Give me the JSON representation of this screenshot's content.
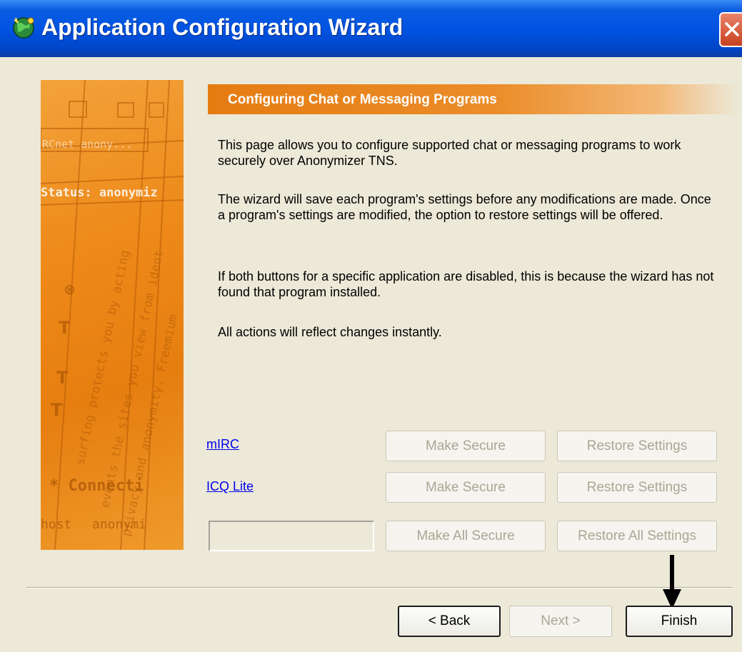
{
  "window": {
    "title": "Application Configuration Wizard",
    "icon": "globe-wizard-icon",
    "close_icon": "close-icon"
  },
  "banner": {
    "image": "anonymizer-banner-image",
    "texts": [
      "RCnet anony...",
      "Status: anonymiz",
      "* Connecti",
      "host",
      "anonymi"
    ]
  },
  "section": {
    "title": "Configuring Chat or Messaging Programs"
  },
  "paragraphs": [
    "This page allows you to configure supported chat or messaging programs to work securely over Anonymizer TNS.",
    "The wizard will save each program's settings before any modifications are made. Once a program's settings are modified, the option to restore settings will be offered.",
    "If both buttons for a specific application are disabled, this is because the wizard has not found that program installed.",
    "All actions will reflect changes instantly."
  ],
  "apps": [
    {
      "name": "mIRC",
      "make_secure": "Make Secure",
      "restore": "Restore Settings",
      "enabled": false
    },
    {
      "name": "ICQ Lite",
      "make_secure": "Make Secure",
      "restore": "Restore Settings",
      "enabled": false
    }
  ],
  "all_actions": {
    "make_all_secure": "Make All Secure",
    "restore_all": "Restore All Settings",
    "status_value": ""
  },
  "nav": {
    "back": "< Back",
    "next": "Next >",
    "finish": "Finish",
    "back_enabled": true,
    "next_enabled": false,
    "finish_enabled": true
  },
  "annotation": "arrow-down-icon",
  "colors": {
    "title_bar": "#0054e3",
    "header_orange": "#e57c12",
    "window_bg": "#ece9d8",
    "link": "#0000ee",
    "disabled_text": "#a9a796"
  }
}
